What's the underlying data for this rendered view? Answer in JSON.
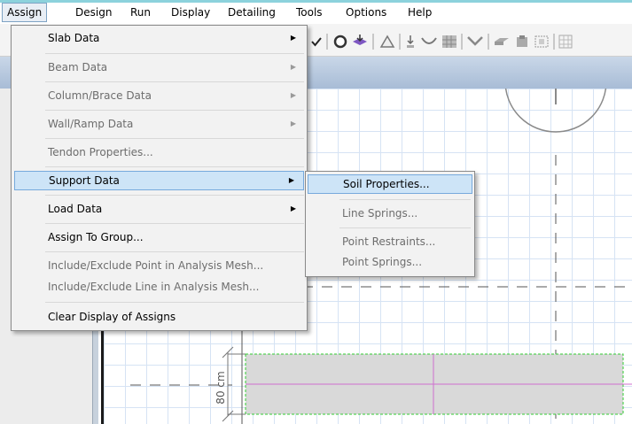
{
  "menubar": {
    "items": [
      "Assign",
      "Design",
      "Run",
      "Display",
      "Detailing",
      "Tools",
      "Options",
      "Help"
    ]
  },
  "assign_menu": {
    "slab_data": "Slab Data",
    "beam_data": "Beam Data",
    "column_brace_data": "Column/Brace Data",
    "wall_ramp_data": "Wall/Ramp Data",
    "tendon_properties": "Tendon Properties...",
    "support_data": "Support Data",
    "load_data": "Load Data",
    "assign_to_group": "Assign To Group...",
    "include_exclude_point": "Include/Exclude Point in Analysis Mesh...",
    "include_exclude_line": "Include/Exclude Line in Analysis Mesh...",
    "clear_display": "Clear Display of Assigns"
  },
  "support_submenu": {
    "soil_properties": "Soil Properties...",
    "line_springs": "Line Springs...",
    "point_restraints": "Point Restraints...",
    "point_springs": "Point Springs..."
  },
  "canvas": {
    "dimension_label": "80 cm"
  },
  "colors": {
    "highlight": "#cde4f7",
    "highlight_border": "#76a9dc",
    "grid": "#d6e3f4",
    "beam_fill": "#d9d9d9",
    "beam_outline": "#33cc33",
    "magenta_line": "#d070d0"
  }
}
